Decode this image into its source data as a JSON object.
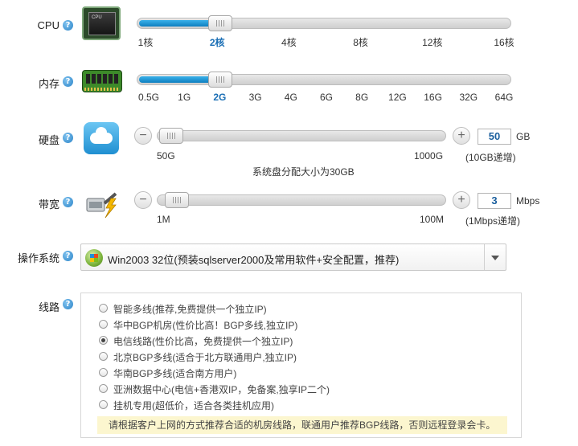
{
  "colors": {
    "accent": "#0e7fc0",
    "active_tick": "#1b6fb5",
    "tip_bg": "#fcf6cf"
  },
  "cpu": {
    "label": "CPU",
    "icon": "cpu-chip-icon",
    "chip_text": "CPU",
    "ticks": [
      "1核",
      "2核",
      "4核",
      "8核",
      "12核",
      "16核"
    ],
    "selected": "2核",
    "level_fraction": 0.2
  },
  "memory": {
    "label": "内存",
    "icon": "memory-stick-icon",
    "ticks": [
      "0.5G",
      "1G",
      "2G",
      "3G",
      "4G",
      "6G",
      "8G",
      "12G",
      "16G",
      "32G",
      "64G"
    ],
    "selected": "2G",
    "level_fraction": 0.2
  },
  "disk": {
    "label": "硬盘",
    "icon": "cloud-disk-icon",
    "min_label": "50G",
    "max_label": "1000G",
    "value": "50",
    "unit": "GB",
    "step_note": "(10GB递增)",
    "system_note": "系统盘分配大小为30GB",
    "level_fraction": 0
  },
  "bandwidth": {
    "label": "带宽",
    "icon": "network-cable-icon",
    "min_label": "1M",
    "max_label": "100M",
    "value": "3",
    "unit": "Mbps",
    "step_note": "(1Mbps递增)",
    "level_fraction": 0.02
  },
  "os": {
    "label": "操作系统",
    "icon": "windows-logo-icon",
    "selected": "Win2003 32位(预装sqlserver2000及常用软件+安全配置，推荐)"
  },
  "line": {
    "label": "线路",
    "options": [
      "智能多线(推荐,免费提供一个独立IP)",
      "华中BGP机房(性价比高！BGP多线,独立IP)",
      "电信线路(性价比高，免费提供一个独立IP)",
      "北京BGP多线(适合于北方联通用户,独立IP)",
      "华南BGP多线(适合南方用户)",
      "亚洲数据中心(电信+香港双IP，免备案,独享IP二个)",
      "挂机专用(超低价，适合各类挂机应用)"
    ],
    "selected_index": 2,
    "tip": "请根据客户上网的方式推荐合适的机房线路，联通用户推荐BGP线路，否则远程登录会卡。"
  },
  "help_glyph": "?",
  "minus_glyph": "−",
  "plus_glyph": "+"
}
